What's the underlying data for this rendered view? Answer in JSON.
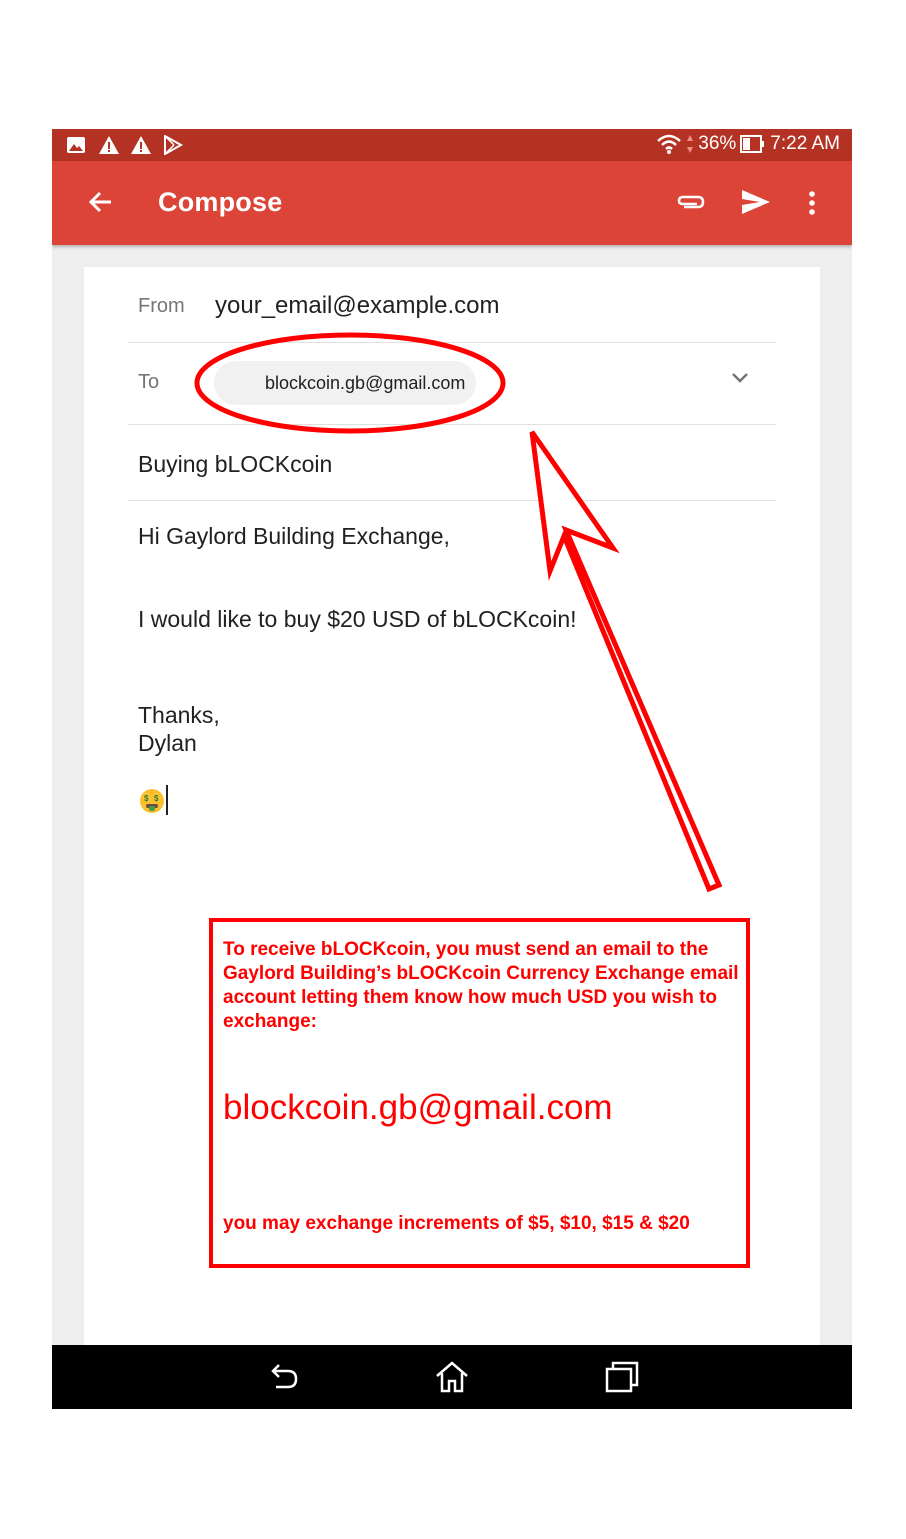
{
  "status_bar": {
    "battery": "36%",
    "time": "7:22 AM"
  },
  "app_bar": {
    "title": "Compose",
    "icons": [
      "back-arrow-icon",
      "attach-icon",
      "send-icon",
      "more-vert-icon"
    ]
  },
  "compose": {
    "from_label": "From",
    "from_value": "your_email@example.com",
    "to_label": "To",
    "to_chip": "blockcoin.gb@gmail.com",
    "subject": "Buying bLOCKcoin",
    "body": {
      "greeting": "Hi Gaylord Building Exchange,",
      "message": "I would like to buy $20 USD of bLOCKcoin!",
      "signoff": "Thanks,",
      "name": "Dylan"
    }
  },
  "annotation": {
    "instructions": "To receive bLOCKcoin, you must send an email to the Gaylord Building’s bLOCKcoin Currency Exchange email account letting them know how much USD you wish to exchange:",
    "email": "blockcoin.gb@gmail.com",
    "increments": "you may exchange increments of $5, $10, $15 & $20",
    "color": "#ff0000"
  },
  "colors": {
    "status_bar": "#b33224",
    "app_bar": "#db4437",
    "background": "#eeeeee"
  }
}
